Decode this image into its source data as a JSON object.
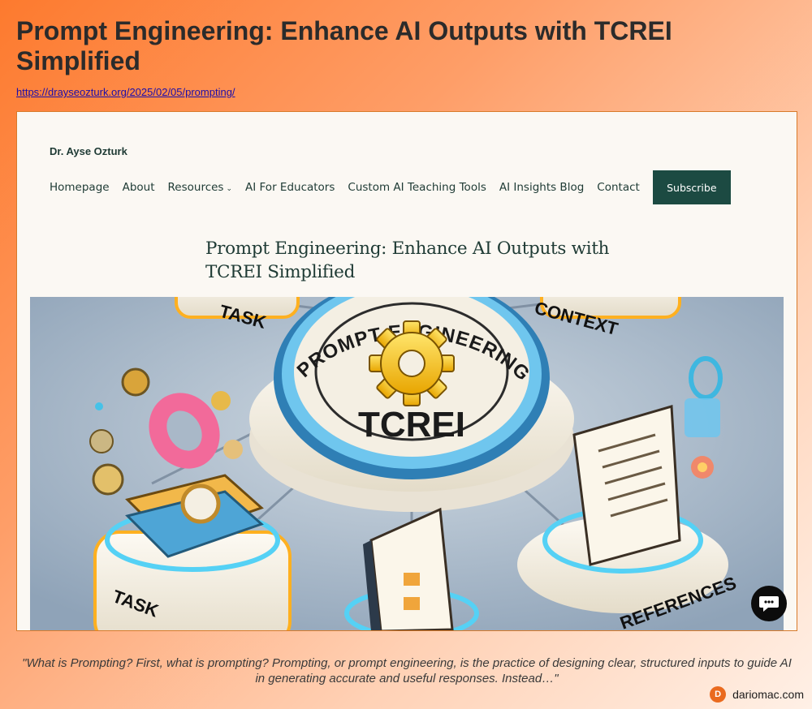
{
  "header": {
    "title": "Prompt Engineering: Enhance AI Outputs with TCREI Simplified",
    "url": "https://drayseozturk.org/2025/02/05/prompting/"
  },
  "site": {
    "name": "Dr. Ayse Ozturk",
    "nav": [
      {
        "label": "Homepage"
      },
      {
        "label": "About"
      },
      {
        "label": "Resources",
        "has_dropdown": true
      },
      {
        "label": "AI For Educators"
      },
      {
        "label": "Custom AI Teaching Tools"
      },
      {
        "label": "AI Insights Blog"
      },
      {
        "label": "Contact"
      }
    ],
    "subscribe_label": "Subscribe",
    "accent_color": "#1c4a42"
  },
  "article": {
    "title": "Prompt Engineering: Enhance AI Outputs with TCREI Simplified"
  },
  "hero_image": {
    "ring_text": "PROMPT ENGINEERING",
    "center_text": "TCREI",
    "pedestal_labels": {
      "top_left": "TASK",
      "top_right": "CONTEXT",
      "bottom_left": "TASK",
      "bottom_right": "REFERENCES"
    }
  },
  "chat": {
    "icon": "chat-bubble-icon"
  },
  "quote": "\"What is Prompting? First, what is prompting? Prompting, or prompt engineering, is the practice of designing clear, structured inputs to guide AI in generating accurate and useful responses. Instead…\"",
  "brand": {
    "logo_letter": "D",
    "name": "dariomac.com",
    "color": "#ea6a1e"
  }
}
